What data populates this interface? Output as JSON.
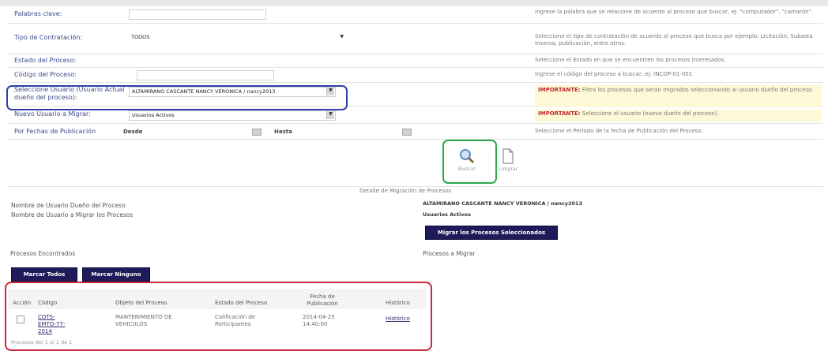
{
  "form": {
    "keywords": {
      "label": "Palabras clave:",
      "value": "",
      "help": "Ingrese la palabra que se relacione de acuerdo al proceso que buscar, ej: \"computador\", \"camarón\"."
    },
    "contract_type": {
      "label": "Tipo de Contratación:",
      "value": "TODOS",
      "help": "Seleccione el tipo de contratación de acuerdo al proceso que busca por ejemplo: Licitación, Subasta Inversa, publicación, entre otros."
    },
    "process_state": {
      "label": "Estado del Proceso:",
      "help": "Seleccione el Estado en que se encuentren los procesos interesados."
    },
    "process_code": {
      "label": "Código del Proceso:",
      "value": "",
      "help": "Ingrese el código del proceso a buscar, ej: INCOP-01-001"
    },
    "owner_user": {
      "label": "Seleccione Usuario (Usuario Actual dueño del proceso):",
      "value": "ALTAMIRANO CASCANTE NANCY VERONICA / nancy2013",
      "help_strong": "IMPORTANTE:",
      "help": " Filtra los procesos que serán migrados seleccionando al usuario dueño del proceso."
    },
    "new_user": {
      "label": "Nuevo Usuario a Migrar:",
      "value": "Usuarios Activos",
      "help_strong": "IMPORTANTE:",
      "help": " Seleccione el usuario (nuevo dueño del proceso)."
    },
    "pub_dates": {
      "label": "Por Fechas de Publicación",
      "from_label": "Desde:",
      "to_label": "Hasta:",
      "help": "Seleccione el Período de la fecha de Publicación del Proceso."
    }
  },
  "actions": {
    "search_label": "Buscar",
    "clear_label": "Limpiar"
  },
  "detail": {
    "title": "Detalle de Migración de Procesos",
    "owner_label": "Nombre de Usuario Dueño del Proceso",
    "owner_value": "ALTAMIRANO CASCANTE NANCY VERONICA / nancy2013",
    "target_label": "Nombre de Usuario a Migrar los Procesos",
    "target_value": "Usuarios Activos",
    "migrate_button": "Migrar los Procesos Seleccionados"
  },
  "results": {
    "found_label": "Procesos Encontrados",
    "to_migrate_label": "Procesos a Migrar",
    "mark_all": "Marcar Todos",
    "mark_none": "Marcar Ninguno",
    "columns": [
      "Acción",
      "Código",
      "Objeto del Proceso",
      "Estado del Proceso",
      "Fecha de Publicación",
      "Histórico"
    ],
    "rows": [
      {
        "code": "COTS-EMTO-77-2014",
        "object": "MANTENIMIENTO DE VEHICULOS",
        "state": "Calificación de Participantes",
        "date": "2014-04-25 14:40:00",
        "history": "Histórico"
      }
    ],
    "pagination": "Procesos del 1 al 1 de 1"
  },
  "colors": {
    "label": "#3d4a8a",
    "button_dark": "#1e1b5a",
    "warn_bg": "#fdf8d6",
    "blue_outline": "#2f3fae",
    "green_outline": "#2aa84a",
    "red_outline": "#c8283a"
  }
}
